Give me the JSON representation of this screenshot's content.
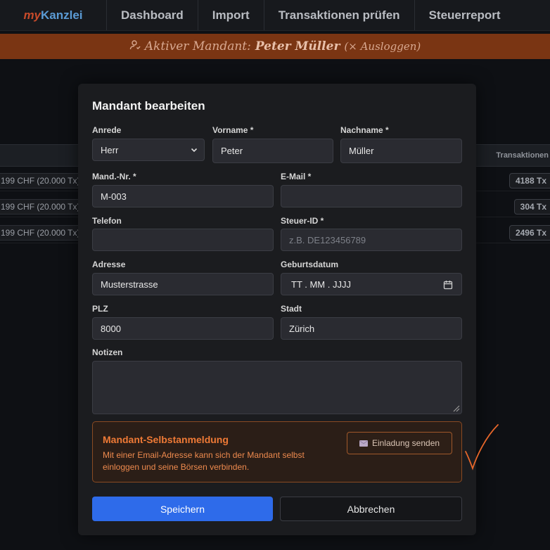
{
  "nav": {
    "logo_my": "my",
    "logo_rest": "Kanzlei",
    "items": [
      "Dashboard",
      "Import",
      "Transaktionen prüfen",
      "Steuerreport"
    ]
  },
  "banner": {
    "prefix": "Aktiver Mandant:",
    "client_name": "Peter Müller",
    "logout": "(× Ausloggen)"
  },
  "background_table": {
    "column_header": "Transaktionen",
    "rows": [
      {
        "plan": "199 CHF (20.000 Tx)",
        "tx": "4188 Tx"
      },
      {
        "plan": "199 CHF (20.000 Tx)",
        "tx": "304 Tx"
      },
      {
        "plan": "199 CHF (20.000 Tx)",
        "tx": "2496 Tx"
      }
    ]
  },
  "modal": {
    "title": "Mandant bearbeiten",
    "fields": {
      "anrede": {
        "label": "Anrede",
        "value": "Herr"
      },
      "vorname": {
        "label": "Vorname *",
        "value": "Peter"
      },
      "nachname": {
        "label": "Nachname *",
        "value": "Müller"
      },
      "mandnr": {
        "label": "Mand.-Nr. *",
        "value": "M-003"
      },
      "email": {
        "label": "E-Mail *",
        "value": ""
      },
      "telefon": {
        "label": "Telefon",
        "value": ""
      },
      "steuerid": {
        "label": "Steuer-ID *",
        "value": "",
        "placeholder": "z.B. DE123456789"
      },
      "adresse": {
        "label": "Adresse",
        "value": "Musterstrasse"
      },
      "geburtsdatum": {
        "label": "Geburtsdatum",
        "value": "",
        "placeholder": "TT . MM . JJJJ"
      },
      "plz": {
        "label": "PLZ",
        "value": "8000"
      },
      "stadt": {
        "label": "Stadt",
        "value": "Zürich"
      },
      "notizen": {
        "label": "Notizen",
        "value": ""
      }
    },
    "self_registration": {
      "title": "Mandant-Selbstanmeldung",
      "description": "Mit einer Email-Adresse kann sich der Mandant selbst einloggen und seine Börsen verbinden.",
      "button": "Einladung senden"
    },
    "save_button": "Speichern",
    "cancel_button": "Abbrechen"
  },
  "colors": {
    "accent": "#2e6bea",
    "banner": "#7a3513",
    "warning": "#ef7a36",
    "checkmark": "#e8672a"
  }
}
